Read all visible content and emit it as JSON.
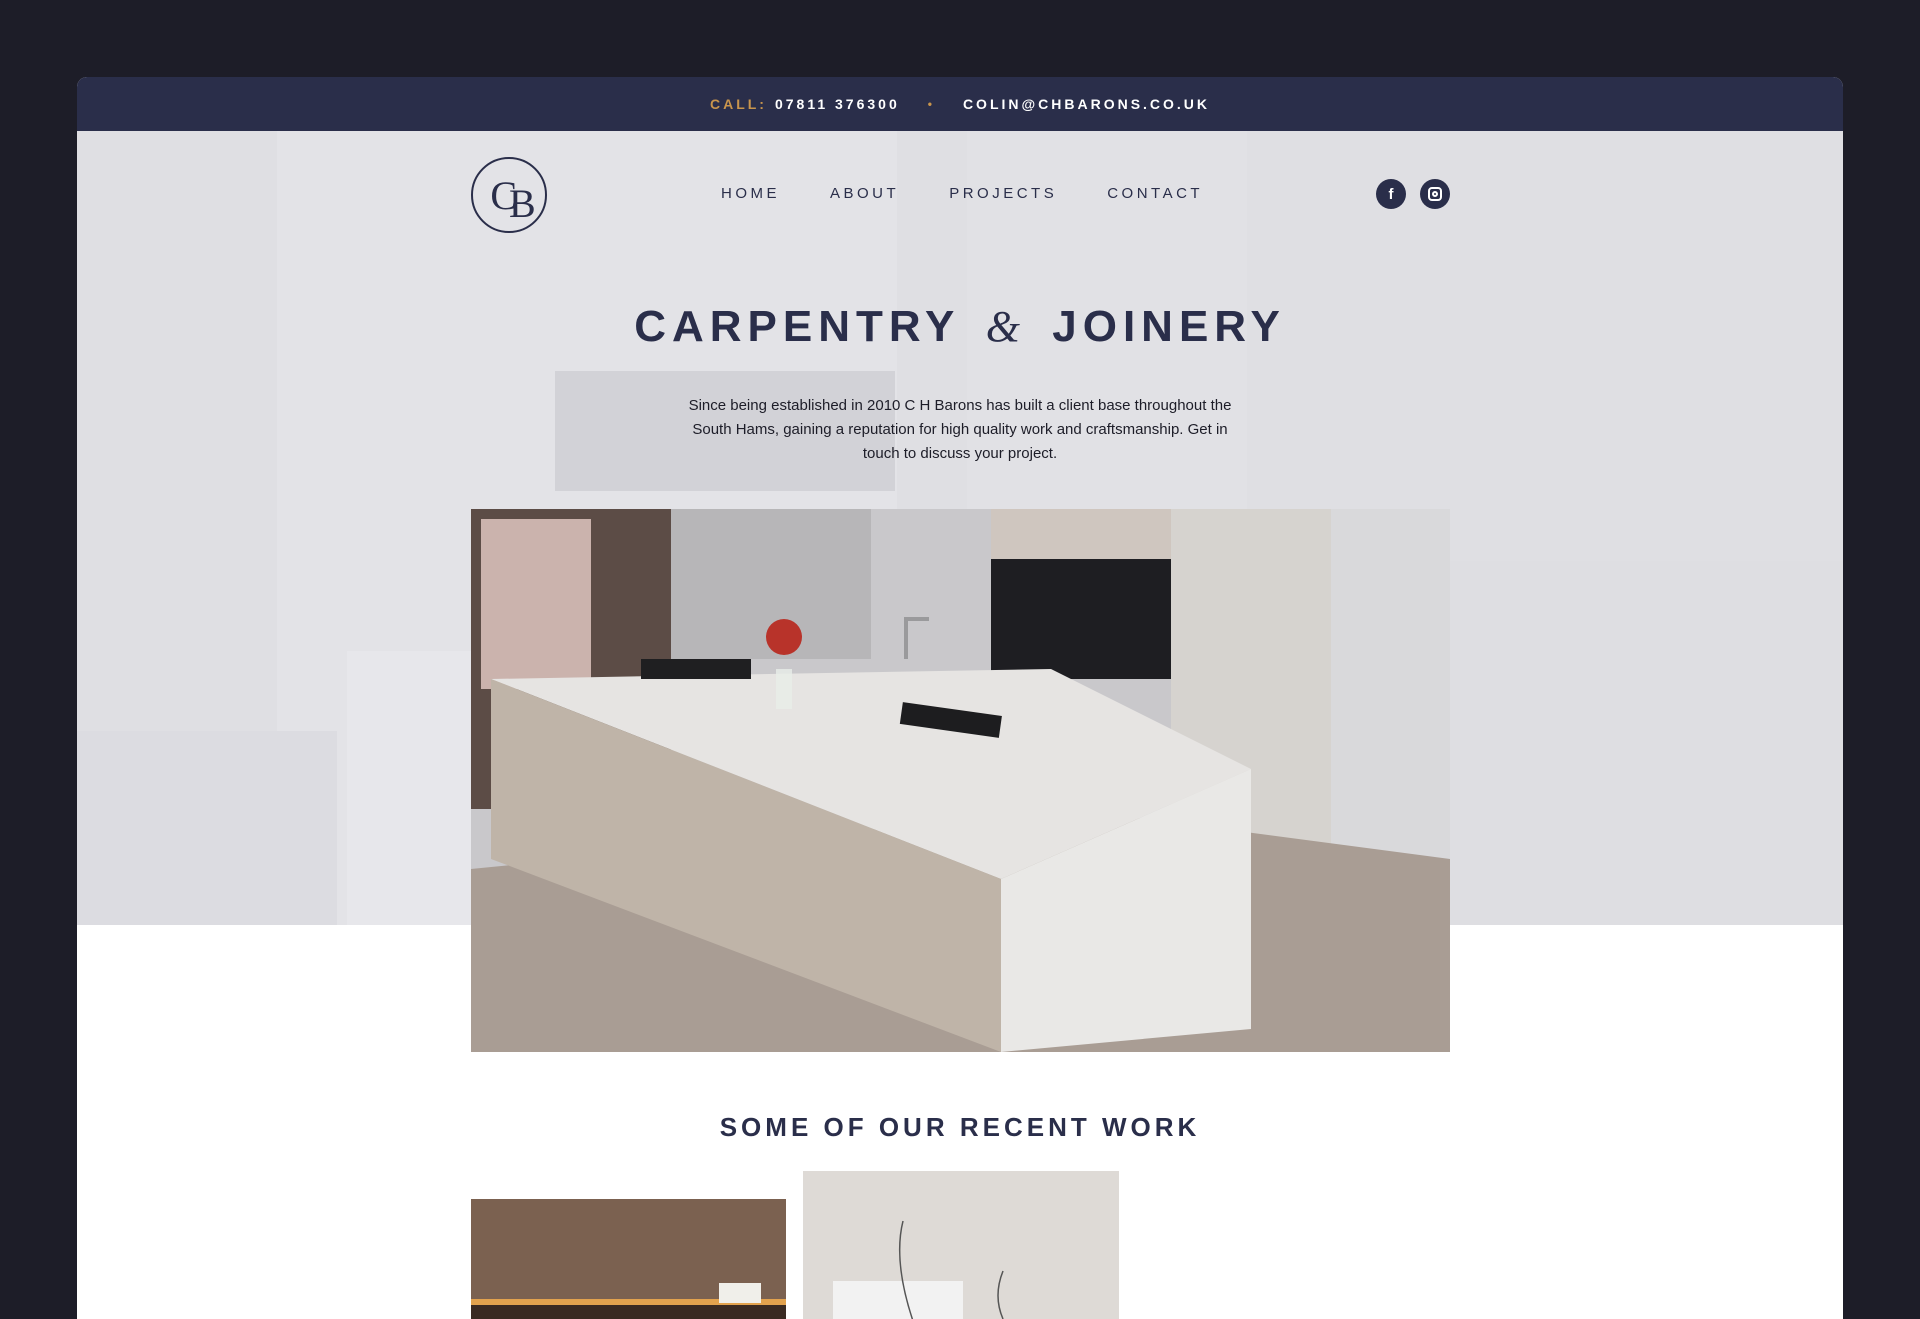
{
  "topbar": {
    "call_label": "CALL:",
    "phone": "07811 376300",
    "separator": "•",
    "email": "COLIN@CHBARONS.CO.UK"
  },
  "logo": {
    "letters": [
      "C",
      "B"
    ]
  },
  "nav": {
    "items": [
      {
        "label": "HOME"
      },
      {
        "label": "ABOUT"
      },
      {
        "label": "PROJECTS"
      },
      {
        "label": "CONTACT"
      }
    ]
  },
  "social": {
    "facebook_glyph": "f",
    "facebook_icon": "facebook-icon",
    "instagram_icon": "instagram-icon"
  },
  "hero": {
    "title_left": "CARPENTRY",
    "title_amp": "&",
    "title_right": "JOINERY",
    "text": "Since being established in 2010 C H Barons has built a client base throughout the South Hams, gaining a reputation for high quality work and craftsmanship. Get in touch to discuss your project."
  },
  "recent_work": {
    "title": "SOME OF OUR RECENT WORK"
  },
  "colors": {
    "navy": "#2a2e4a",
    "accent": "#c9954c",
    "outer_background": "#1d1d28"
  }
}
